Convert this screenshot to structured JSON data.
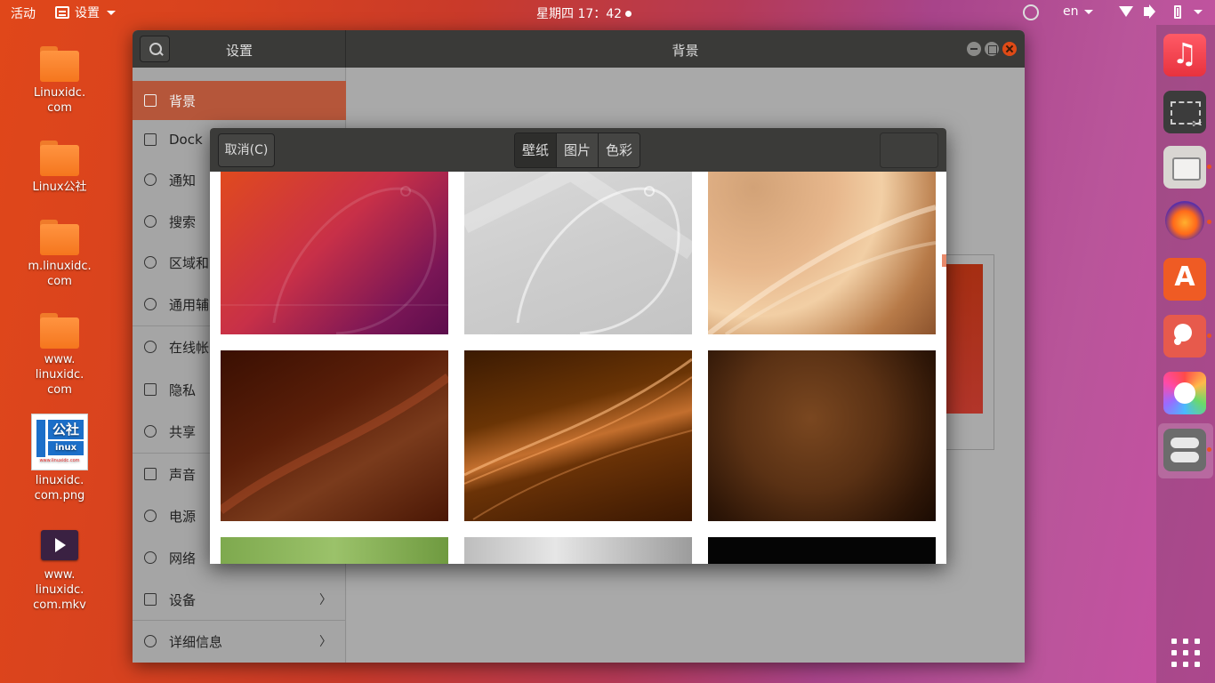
{
  "topbar": {
    "activities": "活动",
    "app_menu": "设置",
    "clock": "星期四 17：42",
    "lang": "en"
  },
  "desktop": {
    "items": [
      {
        "label": "Linuxidc.\ncom",
        "type": "folder"
      },
      {
        "label": "Linux公社",
        "type": "folder"
      },
      {
        "label": "m.linuxidc.\ncom",
        "type": "folder"
      },
      {
        "label": "www.\nlinuxidc.\ncom",
        "type": "folder"
      },
      {
        "label": "linuxidc.\ncom.png",
        "type": "image"
      },
      {
        "label": "www.\nlinuxidc.\ncom.mkv",
        "type": "video"
      }
    ],
    "png_logo": {
      "top": "公社",
      "bottom": "inux",
      "small": "www.linuxidc.com"
    }
  },
  "settings": {
    "sidebar_title": "设置",
    "page_title": "背景",
    "sidebar_items": [
      {
        "label": "背景",
        "icon": "display-icon",
        "active": true
      },
      {
        "label": "Dock",
        "icon": "dock-icon"
      },
      {
        "label": "通知",
        "icon": "bell-icon"
      },
      {
        "label": "搜索",
        "icon": "search-icon"
      },
      {
        "label": "区域和",
        "icon": "globe-icon"
      },
      {
        "label": "通用辅",
        "icon": "accessibility-icon"
      },
      {
        "label": "在线帐",
        "icon": "globe-icon"
      },
      {
        "label": "隐私",
        "icon": "lock-icon"
      },
      {
        "label": "共享",
        "icon": "share-icon"
      },
      {
        "label": "声音",
        "icon": "music-note-icon"
      },
      {
        "label": "电源",
        "icon": "power-icon"
      },
      {
        "label": "网络",
        "icon": "network-icon"
      },
      {
        "label": "设备",
        "icon": "devices-icon",
        "chevron": "〉"
      },
      {
        "label": "详细信息",
        "icon": "info-icon",
        "chevron": "〉"
      }
    ]
  },
  "dialog": {
    "cancel_label": "取消(C)",
    "tabs": [
      {
        "label": "壁纸",
        "active": true
      },
      {
        "label": "图片"
      },
      {
        "label": "色彩"
      }
    ]
  },
  "colors": {
    "accent": "#e95420",
    "sidebar_active": "#b5563a",
    "header": "#3a3a38"
  }
}
